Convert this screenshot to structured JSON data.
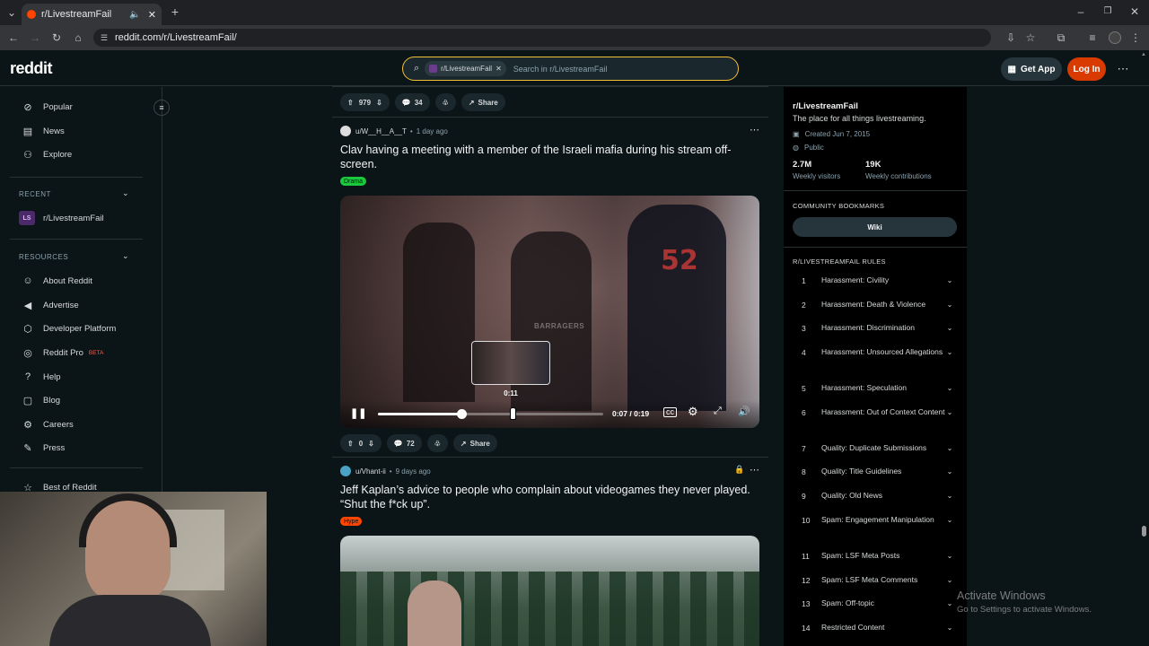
{
  "browser": {
    "tab_title": "r/LivestreamFail",
    "url": "reddit.com/r/LivestreamFail/"
  },
  "header": {
    "logo": "reddit",
    "search_chip": "r/LivestreamFail",
    "search_placeholder": "Search in r/LivestreamFail",
    "get_app": "Get App",
    "login": "Log In"
  },
  "leftnav": {
    "top_items": [
      "Popular",
      "News",
      "Explore"
    ],
    "recent_heading": "RECENT",
    "recent_items": [
      {
        "avatar": "LS",
        "label": "r/LivestreamFail"
      }
    ],
    "resources_heading": "RESOURCES",
    "resources": [
      "About Reddit",
      "Advertise",
      "Developer Platform",
      "Reddit Pro",
      "Help",
      "Blog",
      "Careers",
      "Press"
    ],
    "pro_badge": "BETA",
    "best_of": "Best of Reddit"
  },
  "feed": {
    "prev_post": {
      "votes": "979",
      "comments": "34",
      "share": "Share"
    },
    "post1": {
      "author": "u/W__H__A__T",
      "time": "1 day ago",
      "title": "Clav having a meeting with a member of the Israeli mafia during his stream off-screen.",
      "flair": "Drama",
      "watermark": "BARRAGERS",
      "preview_time": "0:11",
      "time_display": "0:07 / 0:19",
      "progress": 0.37,
      "votes": "0",
      "comments": "72",
      "share": "Share"
    },
    "post2": {
      "author": "u/Vhant-ii",
      "time": "9 days ago",
      "title": "Jeff Kaplan’s advice to people who complain about videogames they never played. “Shut the f*ck up”.",
      "flair": "Hype"
    }
  },
  "sidebar": {
    "name": "r/LivestreamFail",
    "description": "The place for all things livestreaming.",
    "created": "Created Jun 7, 2015",
    "visibility": "Public",
    "visitors_value": "2.7M",
    "visitors_label": "Weekly visitors",
    "contrib_value": "19K",
    "contrib_label": "Weekly contributions",
    "bookmarks_heading": "COMMUNITY BOOKMARKS",
    "wiki": "Wiki",
    "rules_heading": "R/LIVESTREAMFAIL RULES",
    "rules": [
      {
        "n": "1",
        "t": "Harassment: Civility"
      },
      {
        "n": "2",
        "t": "Harassment: Death & Violence"
      },
      {
        "n": "3",
        "t": "Harassment: Discrimination"
      },
      {
        "n": "4",
        "t": "Harassment: Unsourced Allegations"
      },
      {
        "n": "5",
        "t": "Harassment: Speculation"
      },
      {
        "n": "6",
        "t": "Harassment: Out of Context Content"
      },
      {
        "n": "7",
        "t": "Quality: Duplicate Submissions"
      },
      {
        "n": "8",
        "t": "Quality: Title Guidelines"
      },
      {
        "n": "9",
        "t": "Quality: Old News"
      },
      {
        "n": "10",
        "t": "Spam: Engagement Manipulation"
      },
      {
        "n": "11",
        "t": "Spam: LSF Meta Posts"
      },
      {
        "n": "12",
        "t": "Spam: LSF Meta Comments"
      },
      {
        "n": "13",
        "t": "Spam: Off-topic"
      },
      {
        "n": "14",
        "t": "Restricted Content"
      }
    ]
  },
  "overlay": {
    "activate_title": "Activate Windows",
    "activate_sub": "Go to Settings to activate Windows."
  }
}
